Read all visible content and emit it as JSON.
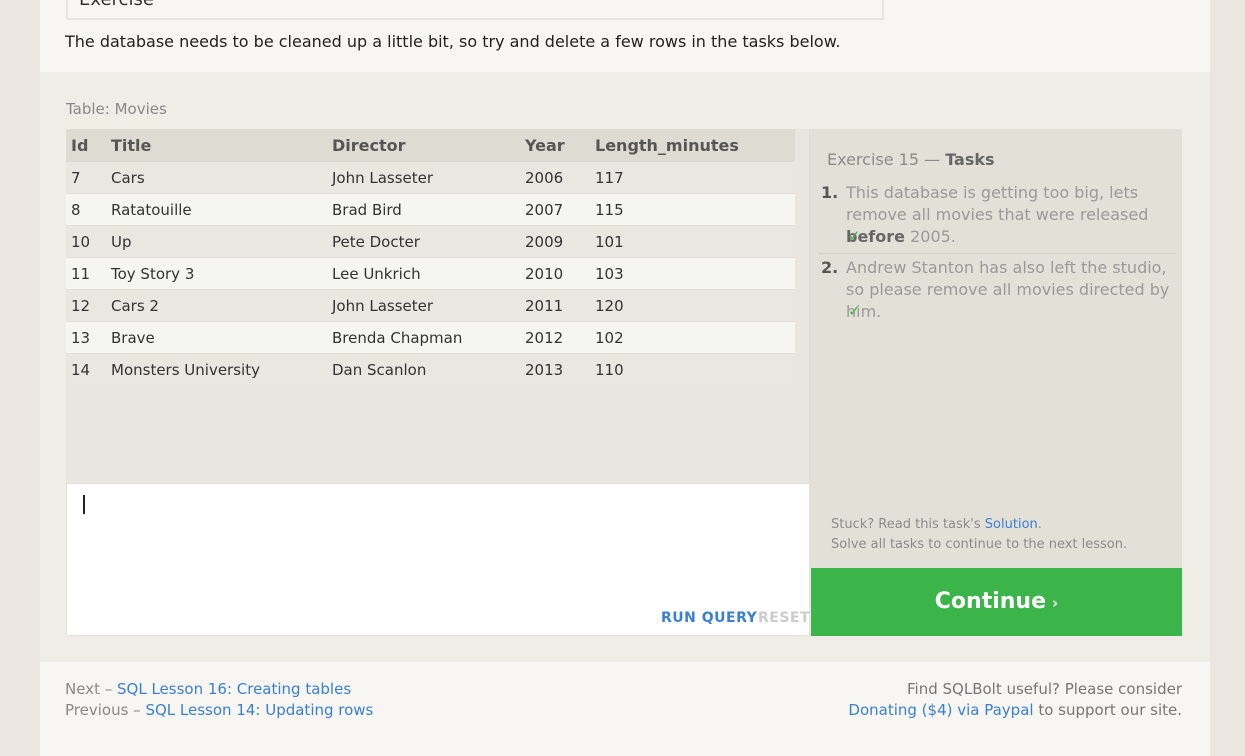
{
  "exercise": {
    "heading": "Exercise",
    "intro": "The database needs to be cleaned up a little bit, so try and delete a few rows in the tasks below."
  },
  "table": {
    "label": "Table: Movies",
    "columns": [
      "Id",
      "Title",
      "Director",
      "Year",
      "Length_minutes"
    ],
    "rows": [
      [
        "7",
        "Cars",
        "John Lasseter",
        "2006",
        "117"
      ],
      [
        "8",
        "Ratatouille",
        "Brad Bird",
        "2007",
        "115"
      ],
      [
        "10",
        "Up",
        "Pete Docter",
        "2009",
        "101"
      ],
      [
        "11",
        "Toy Story 3",
        "Lee Unkrich",
        "2010",
        "103"
      ],
      [
        "12",
        "Cars 2",
        "John Lasseter",
        "2011",
        "120"
      ],
      [
        "13",
        "Brave",
        "Brenda Chapman",
        "2012",
        "102"
      ],
      [
        "14",
        "Monsters University",
        "Dan Scanlon",
        "2013",
        "110"
      ]
    ]
  },
  "editor": {
    "query": "",
    "run_label": "RUN QUERY",
    "reset_label": "RESET"
  },
  "tasks": {
    "title_prefix": "Exercise 15 —",
    "title_bold": "Tasks",
    "items": [
      {
        "num": "1.",
        "text_before": "This database is getting too big, lets remove all movies that were released ",
        "text_bold": "before",
        "text_after": " 2005.",
        "check": "✓"
      },
      {
        "num": "2.",
        "text_before": "Andrew Stanton has also left the studio, so please remove all movies directed by him.",
        "text_bold": "",
        "text_after": "",
        "check": "✓"
      }
    ],
    "stuck_prefix": "Stuck? Read this task's ",
    "stuck_link": "Solution",
    "stuck_suffix": ".",
    "solve_all": "Solve all tasks to continue to the next lesson."
  },
  "continue": {
    "label": "Continue",
    "arrow": "›",
    "color": "#3bb54a"
  },
  "footer": {
    "next_prefix": "Next –",
    "next_link": "SQL Lesson 16: Creating tables",
    "prev_prefix": "Previous –",
    "prev_link": "SQL Lesson 14: Updating rows",
    "find_text": "Find SQLBolt useful? Please consider",
    "donate_link": "Donating ($4) via Paypal",
    "donate_suffix": " to support our site."
  },
  "colors": {
    "link": "#3b7fd1",
    "check": "#4caf50"
  }
}
